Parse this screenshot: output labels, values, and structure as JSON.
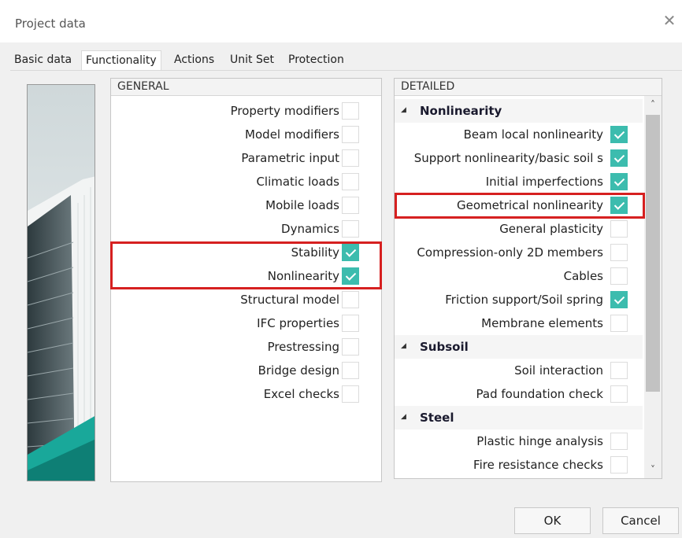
{
  "window": {
    "title": "Project data",
    "close_glyph": "✕"
  },
  "tabs": [
    {
      "label": "Basic data",
      "active": false
    },
    {
      "label": "Functionality",
      "active": true
    },
    {
      "label": "Actions",
      "active": false
    },
    {
      "label": "Unit Set",
      "active": false
    },
    {
      "label": "Protection",
      "active": false
    }
  ],
  "general": {
    "header": "GENERAL",
    "items": [
      {
        "label": "Property modifiers",
        "checked": false
      },
      {
        "label": "Model modifiers",
        "checked": false
      },
      {
        "label": "Parametric input",
        "checked": false
      },
      {
        "label": "Climatic loads",
        "checked": false
      },
      {
        "label": "Mobile loads",
        "checked": false
      },
      {
        "label": "Dynamics",
        "checked": false
      },
      {
        "label": "Stability",
        "checked": true
      },
      {
        "label": "Nonlinearity",
        "checked": true
      },
      {
        "label": "Structural model",
        "checked": false
      },
      {
        "label": "IFC properties",
        "checked": false
      },
      {
        "label": "Prestressing",
        "checked": false
      },
      {
        "label": "Bridge design",
        "checked": false
      },
      {
        "label": "Excel checks",
        "checked": false
      }
    ]
  },
  "detailed": {
    "header": "DETAILED",
    "groups": [
      {
        "title": "Nonlinearity",
        "items": [
          {
            "label": "Beam local nonlinearity",
            "checked": true
          },
          {
            "label": "Support nonlinearity/basic soil s",
            "checked": true
          },
          {
            "label": "Initial imperfections",
            "checked": true
          },
          {
            "label": "Geometrical nonlinearity",
            "checked": true
          },
          {
            "label": "General plasticity",
            "checked": false
          },
          {
            "label": "Compression-only 2D members",
            "checked": false
          },
          {
            "label": "Cables",
            "checked": false
          },
          {
            "label": "Friction support/Soil spring",
            "checked": true
          },
          {
            "label": "Membrane elements",
            "checked": false
          }
        ]
      },
      {
        "title": "Subsoil",
        "items": [
          {
            "label": "Soil interaction",
            "checked": false
          },
          {
            "label": "Pad foundation check",
            "checked": false
          }
        ]
      },
      {
        "title": "Steel",
        "items": [
          {
            "label": "Plastic hinge analysis",
            "checked": false
          },
          {
            "label": "Fire resistance checks",
            "checked": false
          }
        ]
      }
    ]
  },
  "buttons": {
    "ok": "OK",
    "cancel": "Cancel"
  },
  "colors": {
    "check": "#3cbcae",
    "highlight": "#d62020"
  },
  "icons": {
    "close": "close-icon",
    "collapse": "collapse-arrow-icon",
    "scroll_up": "scroll-up-icon",
    "scroll_down": "scroll-down-icon"
  }
}
